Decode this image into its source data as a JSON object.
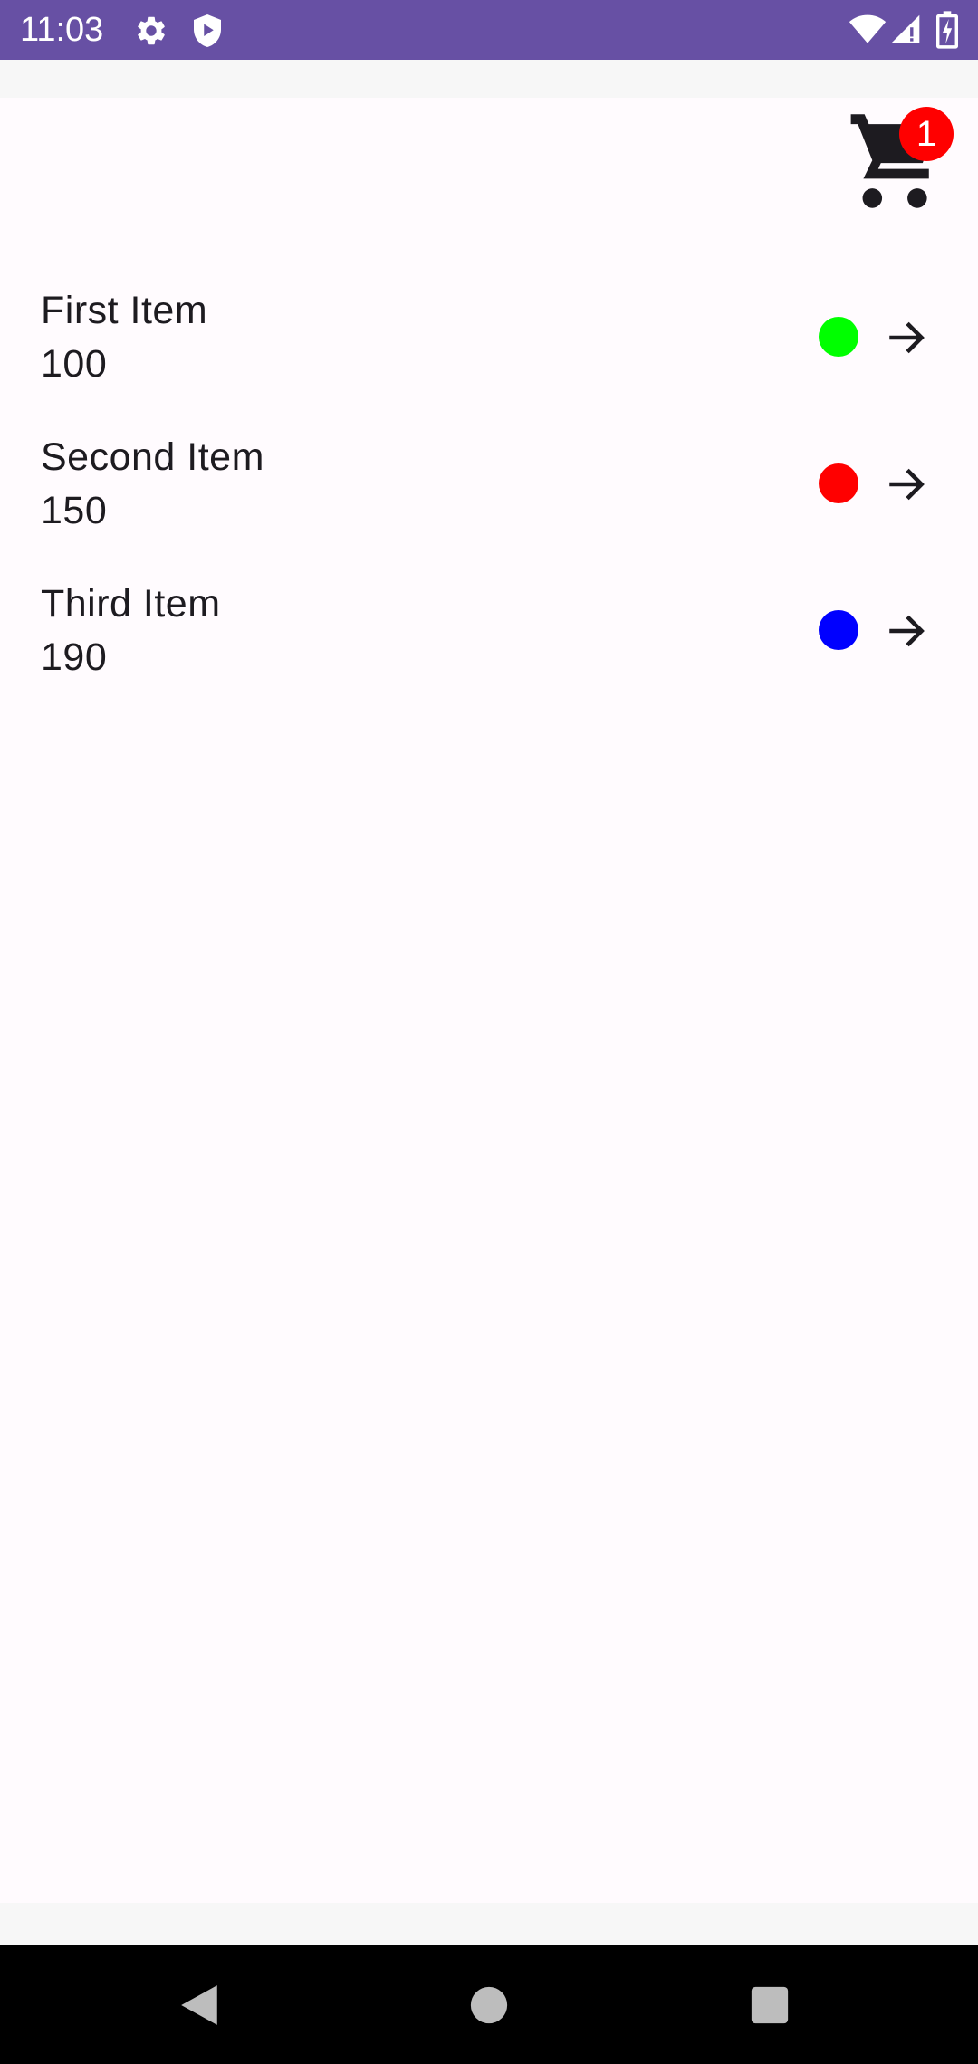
{
  "status_bar": {
    "time": "11:03",
    "background": "#6750a4",
    "left_icons": [
      "settings-gear-icon",
      "shield-icon"
    ],
    "right_icons": [
      "wifi-icon",
      "cellular-signal-icon",
      "battery-charging-icon"
    ]
  },
  "cart": {
    "icon": "shopping-cart-icon",
    "badge_count": "1",
    "badge_color": "#ff0000"
  },
  "items": [
    {
      "name": "First Item",
      "price": "100",
      "color": "#00ff00",
      "icon": "arrow-forward-icon"
    },
    {
      "name": "Second Item",
      "price": "150",
      "color": "#ff0000",
      "icon": "arrow-forward-icon"
    },
    {
      "name": "Third Item",
      "price": "190",
      "color": "#0000ff",
      "icon": "arrow-forward-icon"
    }
  ],
  "nav_bar": {
    "buttons": [
      "back-triangle-icon",
      "home-circle-icon",
      "recents-square-icon"
    ]
  }
}
